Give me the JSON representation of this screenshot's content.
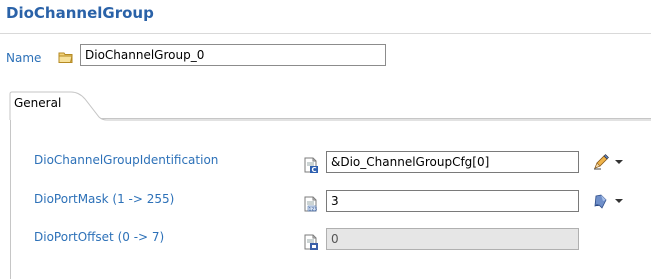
{
  "header": {
    "title": "DioChannelGroup"
  },
  "name_row": {
    "label": "Name",
    "value": "DioChannelGroup_0"
  },
  "tabs": [
    {
      "label": "General",
      "active": true
    }
  ],
  "fields": [
    {
      "label": "DioChannelGroupIdentification",
      "value": "&Dio_ChannelGroupCfg[0]",
      "icon": "code-reference-icon",
      "action_icon": "edit-pencil-icon",
      "editable": true
    },
    {
      "label": "DioPortMask (1 -> 255)",
      "value": "3",
      "icon": "number-field-icon",
      "action_icon": "reset-default-icon",
      "editable": true
    },
    {
      "label": "DioPortOffset (0 -> 7)",
      "value": "0",
      "icon": "number-field-locked-icon",
      "action_icon": null,
      "editable": false
    }
  ],
  "colors": {
    "title": "#2a62a8",
    "label": "#2d71b8",
    "readonly_bg": "#e6e6e6"
  }
}
